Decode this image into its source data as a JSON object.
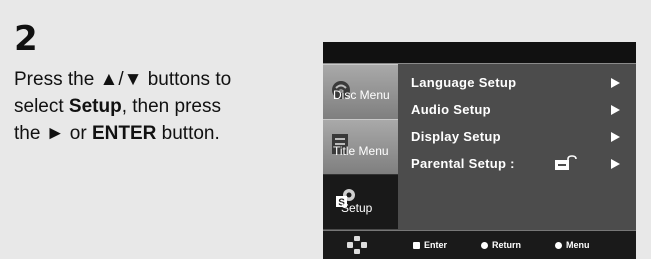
{
  "step": {
    "number": "2"
  },
  "instruction": {
    "line1_pre": "Press the ",
    "line1_keys": "▲/▼",
    "line1_post": " buttons to",
    "line2_pre": "select ",
    "line2_bold": "Setup",
    "line2_post": ", then press",
    "line3_pre": "the ",
    "line3_key": "►",
    "line3_mid": " or ",
    "line3_bold": "ENTER",
    "line3_post": " button."
  },
  "osd": {
    "sidebar": [
      {
        "label": "Disc Menu",
        "icon": "disc-icon",
        "active": false
      },
      {
        "label": "Title Menu",
        "icon": "title-icon",
        "active": false
      },
      {
        "label": "Setup",
        "icon": "setup-icon",
        "active": true
      }
    ],
    "menu": [
      {
        "label": "Language Setup"
      },
      {
        "label": "Audio Setup"
      },
      {
        "label": "Display Setup"
      },
      {
        "label": "Parental Setup :",
        "icon": "lock-icon"
      }
    ],
    "hints": {
      "enter": "Enter",
      "return": "Return",
      "menu": "Menu"
    }
  },
  "colors": {
    "background": "#e8e8e8",
    "osd": "#4c4c4c",
    "osd_bar": "#111111"
  }
}
